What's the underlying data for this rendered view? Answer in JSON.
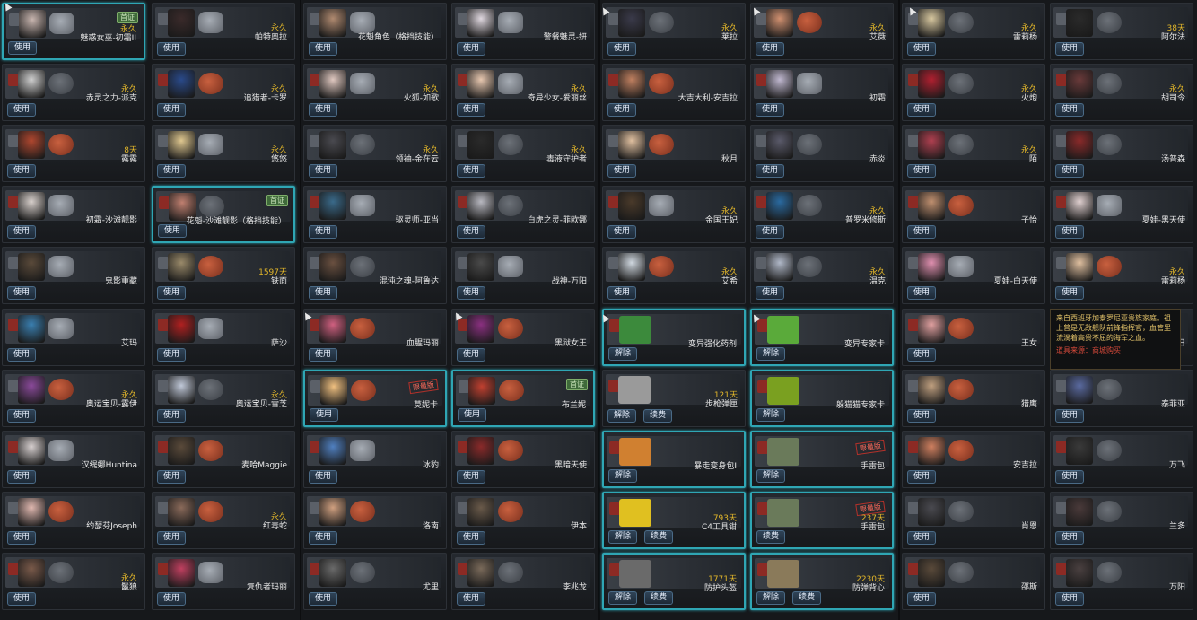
{
  "buttons": {
    "use": "使用",
    "release": "解除",
    "renew": "续费"
  },
  "tooltip": {
    "description": "来自西班牙加泰罗尼亚贵族家庭。祖上曾是无敌舰队前锋指挥官，血管里流淌着高贵不屈的海军之血。",
    "source": "道具来源：商城购买"
  },
  "columns": [
    [
      {
        "name": "魅惑女巫-初霜II",
        "duration": "永久",
        "tag": "首证",
        "role": "star",
        "portrait": "#c9b6b0",
        "highlight": true
      },
      {
        "name": "赤灵之力-派克",
        "duration": "永久",
        "role": "reel",
        "portrait": "#cfcfcf"
      },
      {
        "name": "露露",
        "duration": "8天",
        "role": "fist",
        "portrait": "#b0472f"
      },
      {
        "name": "初霜-沙滩靓影",
        "duration": "",
        "role": "star",
        "portrait": "#d8d0cc"
      },
      {
        "name": "鬼影重藏",
        "duration": "",
        "role": "star",
        "portrait": "#5a4a3a"
      },
      {
        "name": "艾玛",
        "duration": "",
        "role": "star",
        "portrait": "#3a7fb0"
      },
      {
        "name": "奥运宝贝-露伊",
        "duration": "永久",
        "role": "fist",
        "portrait": "#8a4a9a"
      },
      {
        "name": "汉缇娜Huntina",
        "duration": "",
        "role": "star",
        "portrait": "#d6cfcf"
      },
      {
        "name": "约瑟芬Joseph",
        "duration": "",
        "role": "fist",
        "portrait": "#e0b8b0"
      },
      {
        "name": "鬣狼",
        "duration": "永久",
        "role": "reel",
        "portrait": "#7a5a4a"
      }
    ],
    [
      {
        "name": "帕特奥拉",
        "duration": "永久",
        "role": "star",
        "portrait": "#3a2a2a"
      },
      {
        "name": "追猎者-卡罗",
        "duration": "永久",
        "role": "fist",
        "portrait": "#2a4a8a"
      },
      {
        "name": "悠悠",
        "duration": "永久",
        "role": "star",
        "portrait": "#e0c890"
      },
      {
        "name": "花魁-沙滩靓影（格挡技能）",
        "duration": "",
        "tag": "首证",
        "role": "reel",
        "portrait": "#c08070",
        "highlight": true
      },
      {
        "name": "铁面",
        "duration": "1597天",
        "role": "fist",
        "portrait": "#9a8a6a"
      },
      {
        "name": "萨沙",
        "duration": "",
        "role": "star",
        "portrait": "#b02020"
      },
      {
        "name": "奥运宝贝-雪芝",
        "duration": "永久",
        "role": "reel",
        "portrait": "#c0c8d8"
      },
      {
        "name": "麦哈Maggie",
        "duration": "",
        "role": "fist",
        "portrait": "#5a4a3a"
      },
      {
        "name": "红毒蛇",
        "duration": "永久",
        "role": "fist",
        "portrait": "#8a6a5a"
      },
      {
        "name": "复仇者玛丽",
        "duration": "",
        "role": "star",
        "portrait": "#c04060"
      }
    ],
    [
      {
        "name": "花魁角色（格挡技能）",
        "duration": "",
        "role": "star",
        "portrait": "#b08a70"
      },
      {
        "name": "火狐-如歌",
        "duration": "永久",
        "role": "star",
        "portrait": "#e0c8c0"
      },
      {
        "name": "领袖-金在云",
        "duration": "永久",
        "role": "reel",
        "portrait": "#4a4a50"
      },
      {
        "name": "驱灵师-亚当",
        "duration": "",
        "role": "star",
        "portrait": "#3a6a8a"
      },
      {
        "name": "混沌之魂-阿鲁达",
        "duration": "",
        "role": "reel",
        "portrait": "#6a5040"
      },
      {
        "name": "血腥玛丽",
        "duration": "",
        "role": "fist",
        "portrait": "#d06080"
      },
      {
        "name": "莫妮卡",
        "duration": "",
        "stamp": "限量版",
        "role": "fist",
        "portrait": "#f0c080",
        "highlight": true
      },
      {
        "name": "冰豹",
        "duration": "",
        "role": "star",
        "portrait": "#5080c0"
      },
      {
        "name": "洛南",
        "duration": "",
        "role": "fist",
        "portrait": "#d0a080"
      },
      {
        "name": "尤里",
        "duration": "",
        "role": "reel",
        "portrait": "#6a6a6a"
      }
    ],
    [
      {
        "name": "警餐魅灵-妍",
        "duration": "",
        "role": "star",
        "portrait": "#e0d8e0"
      },
      {
        "name": "奇异少女-爱丽丝",
        "duration": "永久",
        "role": "star",
        "portrait": "#e8c8b0"
      },
      {
        "name": "毒液守护者",
        "duration": "永久",
        "role": "reel",
        "portrait": "#2a2a2a"
      },
      {
        "name": "白虎之灵-菲欧娜",
        "duration": "",
        "role": "reel",
        "portrait": "#b8b8c0"
      },
      {
        "name": "战神-万阳",
        "duration": "",
        "role": "star",
        "portrait": "#4a4a4a"
      },
      {
        "name": "黑狱女王",
        "duration": "",
        "role": "fist",
        "portrait": "#8a3080"
      },
      {
        "name": "布兰妮",
        "duration": "",
        "tag": "首证",
        "role": "fist",
        "portrait": "#c04030",
        "highlight": true
      },
      {
        "name": "黑暗天使",
        "duration": "",
        "role": "fist",
        "portrait": "#8a2a2a"
      },
      {
        "name": "伊本",
        "duration": "",
        "role": "fist",
        "portrait": "#6a5a4a"
      },
      {
        "name": "李兆龙",
        "duration": "",
        "role": "reel",
        "portrait": "#7a6a5a"
      }
    ],
    [
      {
        "name": "莱拉",
        "duration": "永久",
        "role": "reel",
        "portrait": "#3a3a4a"
      },
      {
        "name": "大吉大利-安吉拉",
        "duration": "",
        "role": "fist",
        "portrait": "#c08060"
      },
      {
        "name": "秋月",
        "duration": "",
        "role": "fist",
        "portrait": "#e0c0a0"
      },
      {
        "name": "金国王妃",
        "duration": "永久",
        "role": "star",
        "portrait": "#4a3a2a"
      },
      {
        "name": "艾希",
        "duration": "永久",
        "role": "fist",
        "portrait": "#d0d8e0"
      },
      {
        "name": "变异强化药剂",
        "duration": "",
        "item": true,
        "itemColor": "#3c8a3c",
        "buttons": [
          "release"
        ],
        "highlight": true
      },
      {
        "name": "步枪弹匣",
        "duration": "121天",
        "item": true,
        "itemColor": "#9a9a9a",
        "buttons": [
          "release",
          "renew"
        ]
      },
      {
        "name": "暴走变身包I",
        "duration": "",
        "item": true,
        "itemColor": "#d08030",
        "buttons": [
          "release"
        ],
        "highlight": true
      },
      {
        "name": "C4工具钳",
        "duration": "793天",
        "item": true,
        "itemColor": "#e0c020",
        "buttons": [
          "release",
          "renew"
        ],
        "highlight": true
      },
      {
        "name": "防护头盔",
        "duration": "1771天",
        "item": true,
        "itemColor": "#6a6a6a",
        "buttons": [
          "release",
          "renew"
        ],
        "highlight": true
      }
    ],
    [
      {
        "name": "艾薇",
        "duration": "永久",
        "role": "fist",
        "portrait": "#d09070"
      },
      {
        "name": "初霜",
        "duration": "",
        "role": "star",
        "portrait": "#c0b8d0"
      },
      {
        "name": "赤炎",
        "duration": "",
        "role": "reel",
        "portrait": "#5a5a6a"
      },
      {
        "name": "普罗米修斯",
        "duration": "永久",
        "role": "reel",
        "portrait": "#2a6aa0"
      },
      {
        "name": "温克",
        "duration": "永久",
        "role": "reel",
        "portrait": "#b0b8c8"
      },
      {
        "name": "变异专家卡",
        "duration": "",
        "item": true,
        "itemColor": "#5aaa3a",
        "buttons": [
          "release"
        ],
        "highlight": true
      },
      {
        "name": "躲猫猫专家卡",
        "duration": "",
        "item": true,
        "itemColor": "#7aa020",
        "buttons": [
          "release"
        ],
        "highlight": true
      },
      {
        "name": "手雷包",
        "duration": "",
        "stamp": "限量版",
        "item": true,
        "itemColor": "#6a7a5a",
        "buttons": [
          "release"
        ],
        "highlight": true
      },
      {
        "name": "手雷包",
        "duration": "237天",
        "stamp": "限量版",
        "item": true,
        "itemColor": "#6a7a5a",
        "buttons": [
          "renew"
        ],
        "highlight": true
      },
      {
        "name": "防弹背心",
        "duration": "2230天",
        "item": true,
        "itemColor": "#8a7a5a",
        "buttons": [
          "release",
          "renew"
        ],
        "highlight": true
      }
    ],
    [
      {
        "name": "雷莉杨",
        "duration": "永久",
        "role": "reel",
        "portrait": "#d8c8a0"
      },
      {
        "name": "火炮",
        "duration": "永久",
        "role": "reel",
        "portrait": "#b02030"
      },
      {
        "name": "陌",
        "duration": "永久",
        "role": "reel",
        "portrait": "#b04050"
      },
      {
        "name": "子怡",
        "duration": "",
        "role": "fist",
        "portrait": "#c09070"
      },
      {
        "name": "夏娃-白天使",
        "duration": "",
        "role": "star",
        "portrait": "#e090b0"
      },
      {
        "name": "王女",
        "duration": "",
        "role": "fist",
        "portrait": "#e0a0a0"
      },
      {
        "name": "猎鹰",
        "duration": "",
        "role": "fist",
        "portrait": "#c0a080"
      },
      {
        "name": "安吉拉",
        "duration": "",
        "role": "fist",
        "portrait": "#d08060"
      },
      {
        "name": "肖恩",
        "duration": "",
        "role": "reel",
        "portrait": "#4a4a50"
      },
      {
        "name": "邵斯",
        "duration": "",
        "role": "reel",
        "portrait": "#5a4a3a"
      }
    ],
    [
      {
        "name": "阿尔法",
        "duration": "38天",
        "role": "reel",
        "portrait": "#2a2a2a"
      },
      {
        "name": "胡司令",
        "duration": "永久",
        "role": "reel",
        "portrait": "#6a3a3a"
      },
      {
        "name": "汤普森",
        "duration": "",
        "role": "reel",
        "portrait": "#8a2a2a"
      },
      {
        "name": "夏娃-黑天使",
        "duration": "",
        "role": "star",
        "portrait": "#e0d0d0"
      },
      {
        "name": "雷莉杨",
        "duration": "永久",
        "role": "fist",
        "portrait": "#e0c0a0"
      },
      {
        "name": "日",
        "duration": "",
        "role": "reel",
        "portrait": "#6a6a6a"
      },
      {
        "name": "泰菲亚",
        "duration": "",
        "role": "reel",
        "portrait": "#5a6aa0"
      },
      {
        "name": "万飞",
        "duration": "",
        "role": "reel",
        "portrait": "#3a3a3a"
      },
      {
        "name": "兰多",
        "duration": "",
        "role": "reel",
        "portrait": "#4a3a3a"
      },
      {
        "name": "万阳",
        "duration": "",
        "role": "reel",
        "portrait": "#4a4040"
      }
    ]
  ]
}
